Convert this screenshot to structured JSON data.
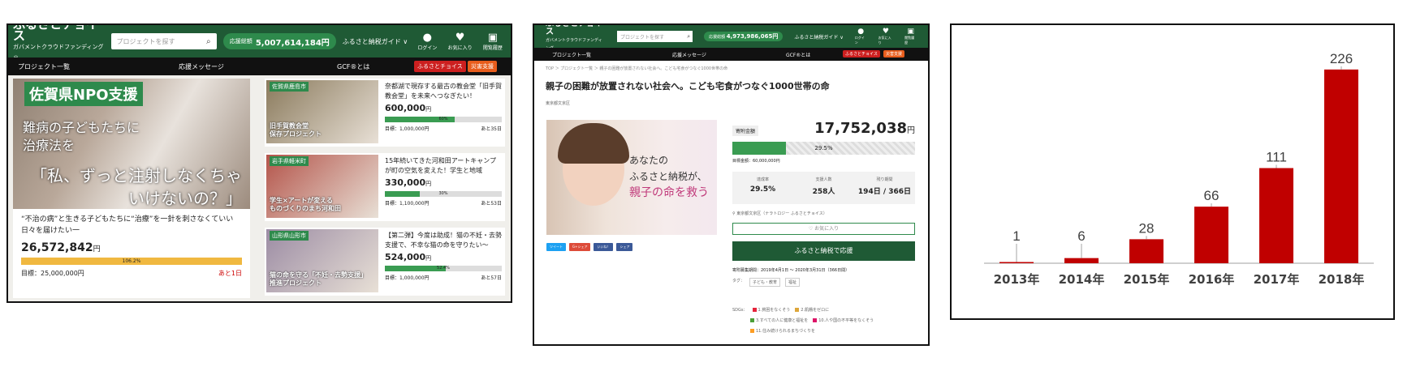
{
  "panel1": {
    "logo": "ふるさとチョイス",
    "logo_sub": "ガバメントクラウドファンディング®",
    "search_placeholder": "プロジェクトを探す",
    "pill_label": "応援総額",
    "pill_amount": "5,007,614,184円",
    "guide": "ふるさと納税ガイド ∨",
    "icons": [
      {
        "name": "login",
        "glyph": "●",
        "label": "ログイン"
      },
      {
        "name": "favorite",
        "glyph": "♥",
        "label": "お気に入り"
      },
      {
        "name": "history",
        "glyph": "▣",
        "label": "閲覧履歴"
      }
    ],
    "nav": [
      "プロジェクト一覧",
      "応援メッセージ",
      "GCF®とは"
    ],
    "nav_red": "ふるさとチョイス",
    "nav_orange": "災害支援",
    "hero": {
      "badge": "佐賀県NPO支援",
      "line1a": "難病の子どもたちに",
      "line1b": "治療法を",
      "line2a": "「私、ずっと注射しなくちゃ",
      "line2b": "いけないの？」",
      "title": "“不治の病”と生きる子どもたちに“治療”を一針を刺さなくていい日々を届けたい一",
      "amount": "26,572,842",
      "yen": "円",
      "progress_label": "106.2%",
      "progress": 100,
      "goal": "目標：25,000,000円",
      "remain": "あと1日",
      "bar_color": "#f0b840"
    },
    "items": [
      {
        "tag": "佐賀県鹿島市",
        "caption1": "旧手賀教会堂",
        "caption2": "保存プロジェクト",
        "title": "奈都湖で現存する最古の教会堂「旧手賀教会堂」を未来へつなぎたい！",
        "amount": "600,000",
        "yen": "円",
        "progress_label": "60%",
        "progress": 60,
        "goal": "目標：1,000,000円",
        "remain": "あと35日",
        "thumb": "#8a7a5c"
      },
      {
        "tag": "岩手県軽米町",
        "caption1": "学生×アートが変える",
        "caption2": "ものづくりのまち河和田",
        "title": "15年続いてきた河和田アートキャンプが町の空気を変えた！学生と地域",
        "amount": "330,000",
        "yen": "円",
        "progress_label": "30%",
        "progress": 30,
        "goal": "目標：1,100,000円",
        "remain": "あと53日",
        "thumb": "#b4544a"
      },
      {
        "tag": "山形県山形市",
        "caption1": "猫の命を守る「不妊・去勢支援」",
        "caption2": "推進プロジェクト",
        "title": "【第二弾】今度は助成！猫の不妊・去勢支援で、不幸な猫の命を守りたい～",
        "amount": "524,000",
        "yen": "円",
        "progress_label": "52.4%",
        "progress": 52.4,
        "goal": "目標：1,000,000円",
        "remain": "あと57日",
        "thumb": "#9c8ca4"
      }
    ]
  },
  "panel2": {
    "logo": "ふるさとチョイス",
    "logo_sub": "ガバメントクラウドファンディング",
    "search_placeholder": "プロジェクトを探す",
    "pill_label": "応援総額",
    "pill_amount": "4,973,986,065円",
    "guide": "ふるさと納税ガイド ∨",
    "icons": [
      {
        "glyph": "●",
        "label": "ログイン"
      },
      {
        "glyph": "♥",
        "label": "お気に入り"
      },
      {
        "glyph": "▣",
        "label": "閲覧履歴"
      }
    ],
    "nav": [
      "プロジェクト一覧",
      "応援メッセージ",
      "GCF®とは"
    ],
    "nav_red": "ふるさとチョイス",
    "nav_orange": "災害支援",
    "crumb": "TOP ＞ プロジェクト一覧 ＞ 親子の困難が放置されない社会へ。こども宅食がつなぐ1000世帯の命",
    "title": "親子の困難が放置されない社会へ。こども宅食がつなぐ1000世帯の命",
    "owner": "東京都文京区",
    "image_text1": "あなたの",
    "image_text2": "ふるさと納税が、",
    "image_text3": "親子の命を救う",
    "share": [
      {
        "label": "ツイート",
        "color": "#1da1f2"
      },
      {
        "label": "G+シェア",
        "color": "#dd4b39"
      },
      {
        "label": "いいね！",
        "color": "#3b5998"
      },
      {
        "label": "シェア",
        "color": "#3b5998"
      }
    ],
    "amount_label": "寄附金額",
    "amount": "17,752,038",
    "yen": "円",
    "progress_label": "29.5%",
    "progress": 29.5,
    "goal": "目標金額：60,000,000円",
    "stats": [
      {
        "label": "達成率",
        "value": "29.5%"
      },
      {
        "label": "支援人数",
        "value": "258人"
      },
      {
        "label": "残り期間",
        "value": "194日 / 366日"
      }
    ],
    "location": "東京都文京区（ナラトロジー ふるさとチョイス）",
    "fav_label": "♡ お気に入り",
    "cta_label": "ふるさと納税で応援",
    "period": "寄附募集期間：2019年4月1日 ～ 2020年3月31日（366日間）",
    "tags_label": "タグ：",
    "tags": [
      "子ども・教育",
      "福祉"
    ],
    "goals_label": "SDGs：",
    "goals": [
      {
        "label": "1.貧困をなくそう",
        "color": "#e5243b"
      },
      {
        "label": "2.飢餓をゼロに",
        "color": "#dda63a"
      },
      {
        "label": "3.すべての人に健康と福祉を",
        "color": "#4c9f38"
      },
      {
        "label": "10.人や国の不平等をなくそう",
        "color": "#dd1367"
      },
      {
        "label": "11.住み続けられるまちづくりを",
        "color": "#fd9d24"
      }
    ]
  },
  "chart_data": {
    "type": "bar",
    "categories": [
      "2013年",
      "2014年",
      "2015年",
      "2016年",
      "2017年",
      "2018年"
    ],
    "values": [
      1,
      6,
      28,
      66,
      111,
      226
    ],
    "ylim": [
      0,
      240
    ],
    "color": "#c00000",
    "grid": false,
    "legend": "none"
  }
}
